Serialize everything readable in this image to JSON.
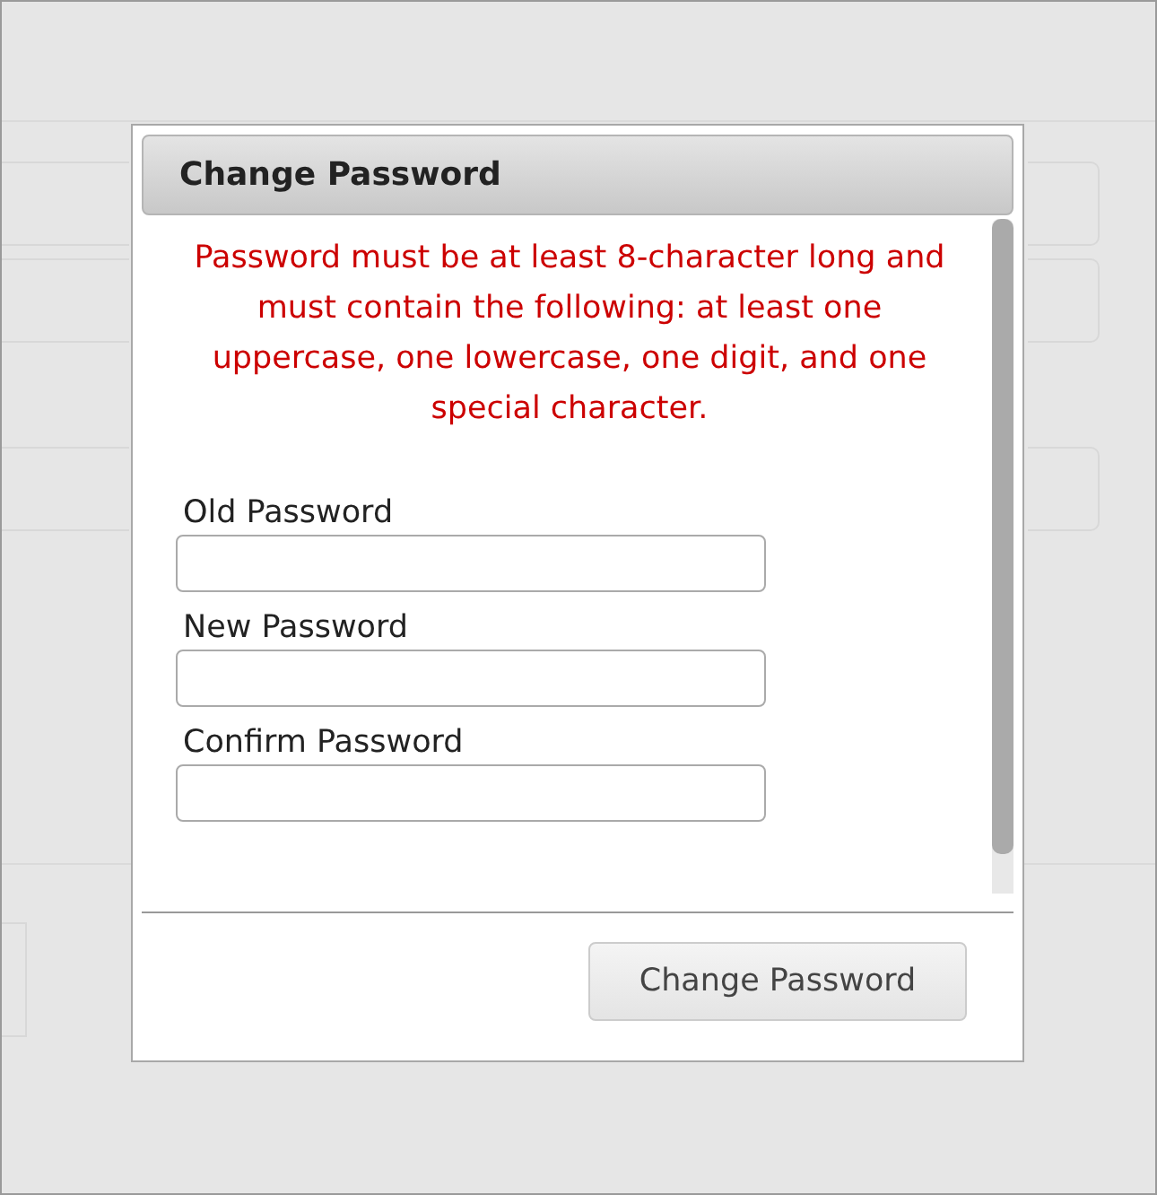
{
  "dialog": {
    "title": "Change Password",
    "notice": "Password must be at least 8-character long and must contain the following: at least one uppercase, one lowercase, one digit, and one special character.",
    "fields": [
      {
        "label": "Old Password"
      },
      {
        "label": "New Password"
      },
      {
        "label": "Confirm Password"
      }
    ],
    "submit_button": "Change Password"
  }
}
